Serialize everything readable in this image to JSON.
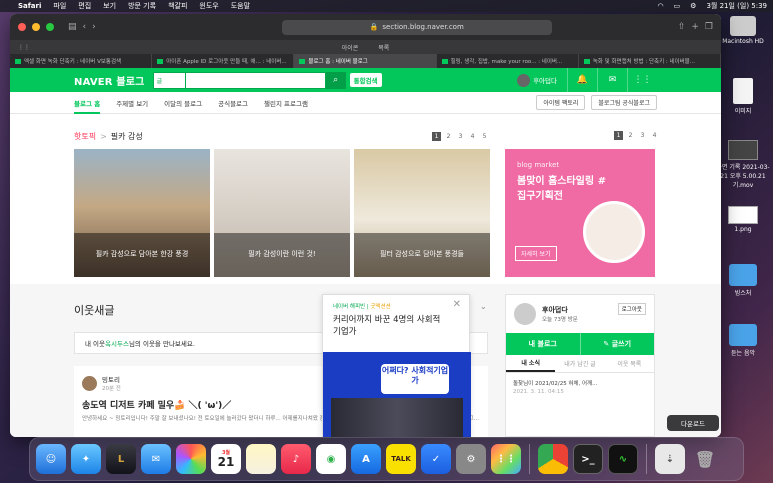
{
  "menubar": {
    "app": "Safari",
    "items": [
      "파일",
      "편집",
      "보기",
      "방문 기록",
      "책갈피",
      "윈도우",
      "도움말"
    ],
    "clock": "3월 21일 (일)  5:39"
  },
  "browser": {
    "url": "section.blog.naver.com",
    "bookmarks": [
      "아이콘",
      "목록"
    ],
    "tabs": [
      {
        "label": "엑셀 화면 녹화 단축키 : 네이버 V보통검색",
        "active": false
      },
      {
        "label": "아이폰 Apple ID 로그아웃 만들 때, 애... : 네이버...",
        "active": false
      },
      {
        "label": "블로그 홈 : 네이버 블로그",
        "active": true
      },
      {
        "label": "힐링, 생각, 집밥, make your roo... : 네이버...",
        "active": false
      },
      {
        "label": "녹화 및 화면캡처 방법 : 단축키 : 네이버블...",
        "active": false
      }
    ]
  },
  "nav": {
    "logo": "NAVER 블로그",
    "search_select": "글",
    "search_placeholder": "",
    "integrated": "통합검색",
    "user": "후아덥다"
  },
  "subnav": {
    "items": [
      "블로그 홈",
      "주제별 보기",
      "이달의 블로그",
      "공식블로그",
      "챌린지 프로그램"
    ],
    "right": [
      "아이템 팩토리",
      "블로그팀 공식블로그"
    ]
  },
  "hot": {
    "label": "핫토픽",
    "arrow": ">",
    "topic": "필카 감성",
    "pages": [
      "1",
      "2",
      "3",
      "4",
      "5"
    ],
    "ad_pages": [
      "1",
      "2",
      "3",
      "4"
    ]
  },
  "cards": [
    {
      "caption": "필카 감성으로 담아본 한강 풍경"
    },
    {
      "caption": "필카 감성이란 이런 것!"
    },
    {
      "caption": "필터 감성으로 담아본 풍경들"
    }
  ],
  "ad": {
    "tag": "blog market",
    "headline": "봄맞이 홈스타일링 #집구기획전",
    "button": "자세히 보기"
  },
  "neighbors": {
    "title": "이웃새글",
    "notice_name": "옥시두스",
    "notice": "내 이웃 옥시두스님의 이웃을 만나보세요.",
    "notice_prefix": "내 이웃 ",
    "notice_suffix": "님의 이웃을 만나보세요."
  },
  "post": {
    "author": "밍토리",
    "time": "20분 전",
    "title": "송도역 디저트 카페 밀우🍰 ＼( 'ω')／",
    "body": "안녕하세요 ~ 밍토리입니다! 주말 잘 보내셨나요! 전 토요일에 놀러갔다 왔더니 하루... 어제를지나쳐왔 잠이났고 좋은가 많이 동네 관해 탐방을 걸려다 어디 가진 했다가 그..."
  },
  "popup": {
    "tag1": "네이버 해피빈",
    "tag2": "굿액션션",
    "title": "커리어까지 바꾼 4명의 사회적기업가",
    "img_text": "어쩌다? 사회적기업가"
  },
  "side": {
    "name": "후아덥다",
    "visits": "오늘 73명 방문",
    "logout": "로그아웃",
    "my_blog": "내 블로그",
    "write": "글쓰기",
    "tabs": [
      "내 소식",
      "내가 남긴 글",
      "이웃 목록"
    ],
    "news": "돌찾님이 2021/02/25 혀체, 어깨...",
    "news_date": "2021. 3. 11. 04:15"
  },
  "desktop": [
    {
      "label": "Macintosh HD"
    },
    {
      "label": "이미지"
    },
    {
      "label": "화면 기록 2021-03-21 오후 5.00.21 기.mov"
    },
    {
      "label": "1.png"
    },
    {
      "label": "빙스처"
    },
    {
      "label": "듣는 음악"
    }
  ],
  "dock": {
    "tooltip": "다운로드",
    "calendar_month": "3월",
    "calendar_day": "21"
  }
}
